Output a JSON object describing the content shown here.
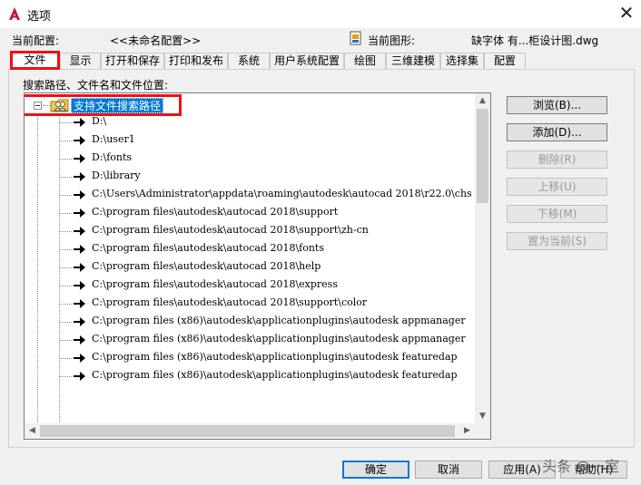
{
  "window": {
    "title": "选项",
    "close_glyph": "✕"
  },
  "profile": {
    "current_profile_label": "当前配置:",
    "current_profile_value": "<<未命名配置>>",
    "current_drawing_label": "当前图形:",
    "current_drawing_value": "缺字体 有...柜设计图.dwg"
  },
  "tabs": [
    {
      "label": "文件",
      "active": true
    },
    {
      "label": "显示"
    },
    {
      "label": "打开和保存"
    },
    {
      "label": "打印和发布"
    },
    {
      "label": "系统"
    },
    {
      "label": "用户系统配置"
    },
    {
      "label": "绘图"
    },
    {
      "label": "三维建模"
    },
    {
      "label": "选择集"
    },
    {
      "label": "配置"
    }
  ],
  "files_panel": {
    "section_label": "搜索路径、文件名和文件位置:",
    "root_label": "支持文件搜索路径",
    "paths": [
      "D:\\",
      "D:\\user1",
      "D:\\fonts",
      "D:\\library",
      "C:\\Users\\Administrator\\appdata\\roaming\\autodesk\\autocad 2018\\r22.0\\chs",
      "C:\\program files\\autodesk\\autocad 2018\\support",
      "C:\\program files\\autodesk\\autocad 2018\\support\\zh-cn",
      "C:\\program files\\autodesk\\autocad 2018\\fonts",
      "C:\\program files\\autodesk\\autocad 2018\\help",
      "C:\\program files\\autodesk\\autocad 2018\\express",
      "C:\\program files\\autodesk\\autocad 2018\\support\\color",
      "C:\\program files (x86)\\autodesk\\applicationplugins\\autodesk appmanager",
      "C:\\program files (x86)\\autodesk\\applicationplugins\\autodesk appmanager",
      "C:\\program files (x86)\\autodesk\\applicationplugins\\autodesk featuredap",
      "C:\\program files (x86)\\autodesk\\applicationplugins\\autodesk featuredap"
    ]
  },
  "side_buttons": {
    "browse": "浏览(B)...",
    "add": "添加(D)...",
    "remove": "删除(R)",
    "move_up": "上移(U)",
    "move_down": "下移(M)",
    "set_current": "置为当前(S)"
  },
  "bottom_buttons": {
    "ok": "确定",
    "cancel": "取消",
    "apply": "应用(A)",
    "help": "帮助(H)"
  },
  "watermark": "头条 @一室",
  "colors": {
    "highlight_red": "#ee1111",
    "selection_blue": "#0078d7",
    "autocad_red": "#c8102e"
  },
  "icons": {
    "app": "autocad-a-icon",
    "drawing": "dwg-file-icon",
    "root": "folder-people-icon",
    "path": "arrow-right-icon"
  }
}
